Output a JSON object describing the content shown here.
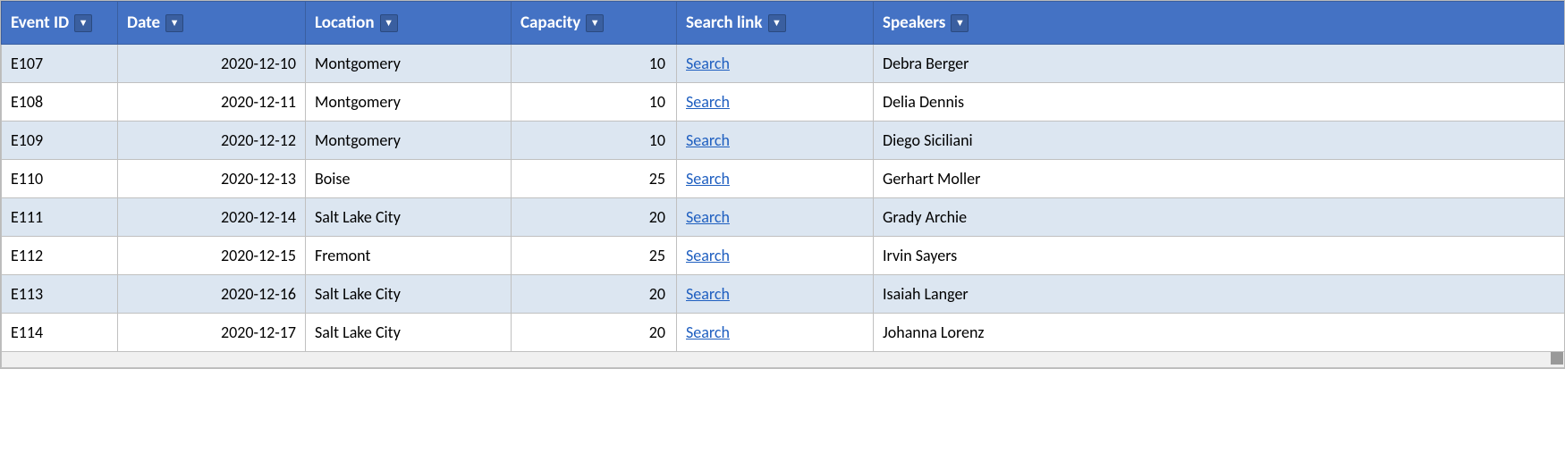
{
  "table": {
    "headers": [
      {
        "id": "event-id",
        "label": "Event ID",
        "hasFilter": true
      },
      {
        "id": "date",
        "label": "Date",
        "hasFilter": true
      },
      {
        "id": "location",
        "label": "Location",
        "hasFilter": true
      },
      {
        "id": "capacity",
        "label": "Capacity",
        "hasFilter": true
      },
      {
        "id": "search-link",
        "label": "Search link",
        "hasFilter": true
      },
      {
        "id": "speakers",
        "label": "Speakers",
        "hasFilter": true
      }
    ],
    "rows": [
      {
        "event_id": "E107",
        "date": "2020-12-10",
        "location": "Montgomery",
        "capacity": "10",
        "search_link": "Search",
        "speakers": "Debra Berger"
      },
      {
        "event_id": "E108",
        "date": "2020-12-11",
        "location": "Montgomery",
        "capacity": "10",
        "search_link": "Search",
        "speakers": "Delia Dennis"
      },
      {
        "event_id": "E109",
        "date": "2020-12-12",
        "location": "Montgomery",
        "capacity": "10",
        "search_link": "Search",
        "speakers": "Diego Siciliani"
      },
      {
        "event_id": "E110",
        "date": "2020-12-13",
        "location": "Boise",
        "capacity": "25",
        "search_link": "Search",
        "speakers": "Gerhart Moller"
      },
      {
        "event_id": "E111",
        "date": "2020-12-14",
        "location": "Salt Lake City",
        "capacity": "20",
        "search_link": "Search",
        "speakers": "Grady Archie"
      },
      {
        "event_id": "E112",
        "date": "2020-12-15",
        "location": "Fremont",
        "capacity": "25",
        "search_link": "Search",
        "speakers": "Irvin Sayers"
      },
      {
        "event_id": "E113",
        "date": "2020-12-16",
        "location": "Salt Lake City",
        "capacity": "20",
        "search_link": "Search",
        "speakers": "Isaiah Langer"
      },
      {
        "event_id": "E114",
        "date": "2020-12-17",
        "location": "Salt Lake City",
        "capacity": "20",
        "search_link": "Search",
        "speakers": "Johanna Lorenz"
      }
    ],
    "filter_icon": "▼"
  }
}
